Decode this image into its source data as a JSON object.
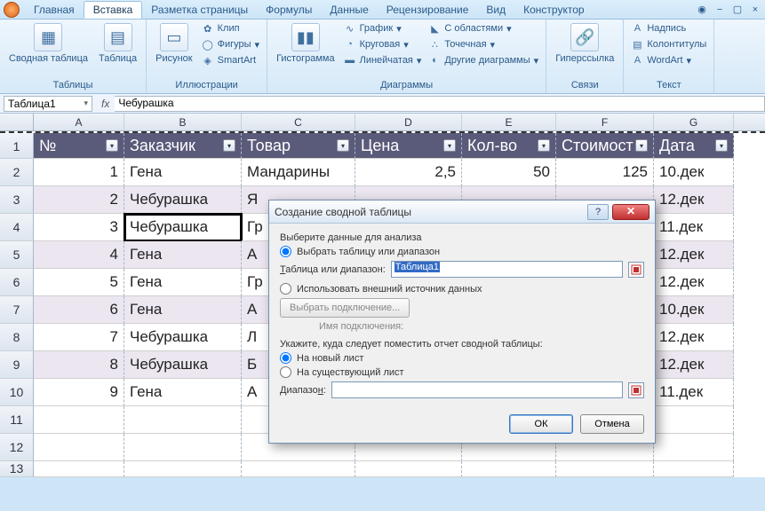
{
  "tabs": {
    "items": [
      "Главная",
      "Вставка",
      "Разметка страницы",
      "Формулы",
      "Данные",
      "Рецензирование",
      "Вид",
      "Конструктор"
    ],
    "active_index": 1
  },
  "ribbon": {
    "groups": {
      "tables": {
        "label": "Таблицы",
        "pivot": "Сводная\nтаблица",
        "table": "Таблица"
      },
      "illustrations": {
        "label": "Иллюстрации",
        "picture": "Рисунок",
        "clip": "Клип",
        "shapes": "Фигуры",
        "smartart": "SmartArt"
      },
      "charts": {
        "label": "Диаграммы",
        "histogram": "Гистограмма",
        "line": "График",
        "pie": "Круговая",
        "bar": "Линейчатая",
        "area": "С областями",
        "scatter": "Точечная",
        "other": "Другие диаграммы"
      },
      "links": {
        "label": "Связи",
        "hyperlink": "Гиперссылка"
      },
      "text": {
        "label": "Текст",
        "textbox": "Надпись",
        "headerfooter": "Колонтитулы",
        "wordart": "WordArt"
      }
    }
  },
  "formula_bar": {
    "name_box": "Таблица1",
    "fx": "fx",
    "value": "Чебурашка"
  },
  "columns": [
    "A",
    "B",
    "C",
    "D",
    "E",
    "F",
    "G"
  ],
  "headers": [
    "№",
    "Заказчик",
    "Товар",
    "Цена",
    "Кол-во",
    "Стоимост",
    "Дата"
  ],
  "rows": [
    {
      "n": "1",
      "z": "Гена",
      "t": "Мандарины",
      "c": "2,5",
      "k": "50",
      "s": "125",
      "d": "10.дек"
    },
    {
      "n": "2",
      "z": "Чебурашка",
      "t": "Я",
      "c": "",
      "k": "",
      "s": "",
      "d": "12.дек"
    },
    {
      "n": "3",
      "z": "Чебурашка",
      "t": "Гр",
      "c": "",
      "k": "",
      "s": "",
      "d": "11.дек"
    },
    {
      "n": "4",
      "z": "Гена",
      "t": "А",
      "c": "",
      "k": "",
      "s": "",
      "d": "12.дек"
    },
    {
      "n": "5",
      "z": "Гена",
      "t": "Гр",
      "c": "",
      "k": "",
      "s": "",
      "d": "12.дек"
    },
    {
      "n": "6",
      "z": "Гена",
      "t": "А",
      "c": "",
      "k": "",
      "s": "",
      "d": "10.дек"
    },
    {
      "n": "7",
      "z": "Чебурашка",
      "t": "Л",
      "c": "",
      "k": "",
      "s": "",
      "d": "12.дек"
    },
    {
      "n": "8",
      "z": "Чебурашка",
      "t": "Б",
      "c": "",
      "k": "",
      "s": "",
      "d": "12.дек"
    },
    {
      "n": "9",
      "z": "Гена",
      "t": "А",
      "c": "",
      "k": "",
      "s": "",
      "d": "11.дек"
    }
  ],
  "dialog": {
    "title": "Создание сводной таблицы",
    "choose_data": "Выберите данные для анализа",
    "opt_range": "Выбрать таблицу или диапазон",
    "range_label": "Таблица или диапазон:",
    "range_value": "Таблица1",
    "opt_external": "Использовать внешний источник данных",
    "choose_conn": "Выбрать подключение...",
    "conn_name_label": "Имя подключения:",
    "place_label": "Укажите, куда следует поместить отчет сводной таблицы:",
    "opt_newsheet": "На новый лист",
    "opt_existing": "На существующий лист",
    "dest_label": "Диапазон:",
    "ok": "ОК",
    "cancel": "Отмена"
  }
}
